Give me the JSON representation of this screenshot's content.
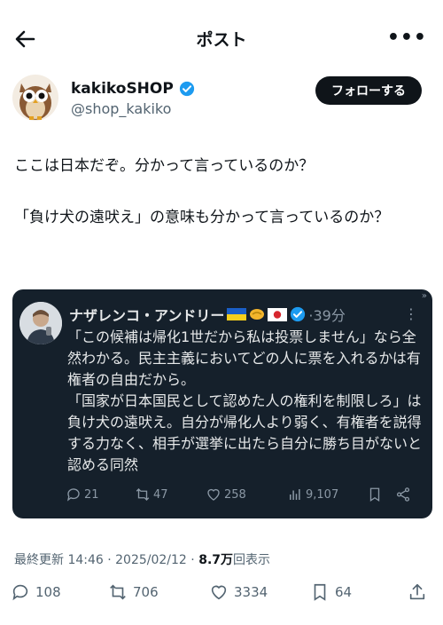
{
  "header": {
    "title": "ポスト"
  },
  "author": {
    "name": "kakikoSHOP",
    "handle": "@shop_kakiko",
    "follow_label": "フォローする"
  },
  "post": {
    "paragraphs": [
      "ここは日本だぞ。分かって言っているのか？",
      "「負け犬の遠吠え」の意味も分かって言っているのか？"
    ]
  },
  "quoted": {
    "name": "ナザレンコ・アンドリー",
    "time": "39分",
    "paragraphs": [
      "「この候補は帰化1世だから私は投票しません」なら全然わかる。民主主義においてどの人に票を入れるかは有権者の自由だから。",
      "「国家が日本国民として認めた人の権利を制限しろ」は負け犬の遠吠え。自分が帰化人より弱く、有権者を説得する力なく、相手が選挙に出たら自分に勝ち目がないと認める同然"
    ],
    "replies": "21",
    "reposts": "47",
    "likes": "258",
    "views": "9,107"
  },
  "meta": {
    "updated": "最終更新 14:46 · 2025/02/12 · ",
    "views_count": "8.7万",
    "views_label": "回表示"
  },
  "stats": {
    "replies": "108",
    "reposts": "706",
    "likes": "3334",
    "bookmarks": "64"
  },
  "colors": {
    "accent_verified": "#1d9bf0",
    "follow_bg": "#0f1419",
    "embed_bg": "#15202b",
    "muted": "#536471"
  }
}
